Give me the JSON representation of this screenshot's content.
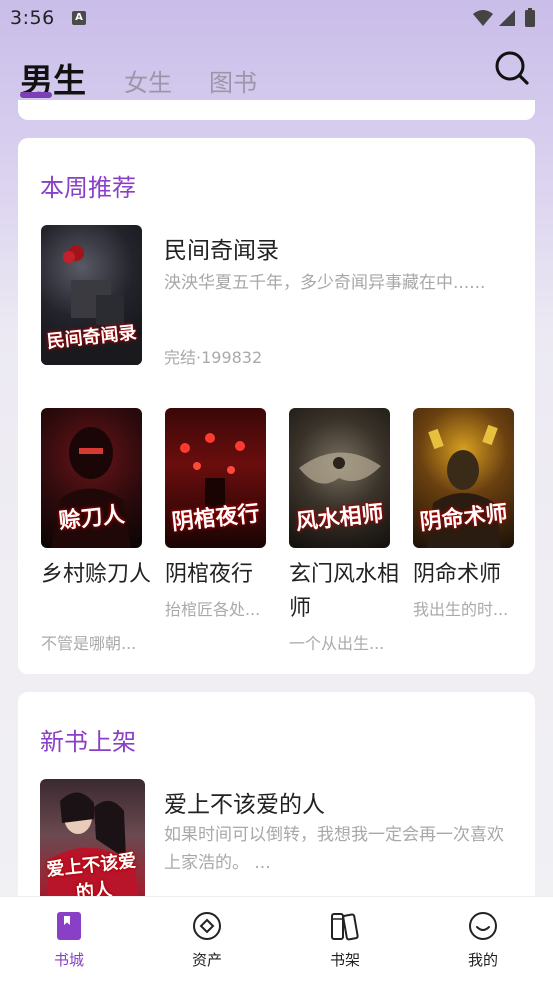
{
  "status_bar": {
    "time": "3:56",
    "notification_badge": "A"
  },
  "top_tabs": [
    {
      "label": "男生",
      "active": true
    },
    {
      "label": "女生",
      "active": false
    },
    {
      "label": "图书",
      "active": false
    }
  ],
  "accent_color": "#8a3fc7",
  "weekly": {
    "title": "本周推荐",
    "featured": {
      "title": "民间奇闻录",
      "description": "泱泱华夏五千年，多少奇闻异事藏在中......",
      "meta": "完结·199832",
      "cover_text": "民间奇闻录"
    },
    "grid": [
      {
        "title": "乡村赊刀人",
        "description": "不管是哪朝...",
        "cover_text": "赊刀人"
      },
      {
        "title": "阴棺夜行",
        "description": "抬棺匠各处...",
        "cover_text": "阴棺夜行"
      },
      {
        "title": "玄门风水相师",
        "description": "一个从出生...",
        "cover_text": "风水相师"
      },
      {
        "title": "阴命术师",
        "description": "我出生的时...",
        "cover_text": "阴命术师"
      }
    ]
  },
  "new_books": {
    "title": "新书上架",
    "featured": {
      "title": "爱上不该爱的人",
      "description_line1": "如果时间可以倒转，我想我一定会再一次喜欢",
      "description_line2": "上家浩的。 ...",
      "cover_text": "爱上不该爱的人"
    }
  },
  "bottom_nav": [
    {
      "label": "书城",
      "icon": "bookstore-icon",
      "active": true
    },
    {
      "label": "资产",
      "icon": "assets-icon",
      "active": false
    },
    {
      "label": "书架",
      "icon": "bookshelf-icon",
      "active": false
    },
    {
      "label": "我的",
      "icon": "profile-icon",
      "active": false
    }
  ]
}
